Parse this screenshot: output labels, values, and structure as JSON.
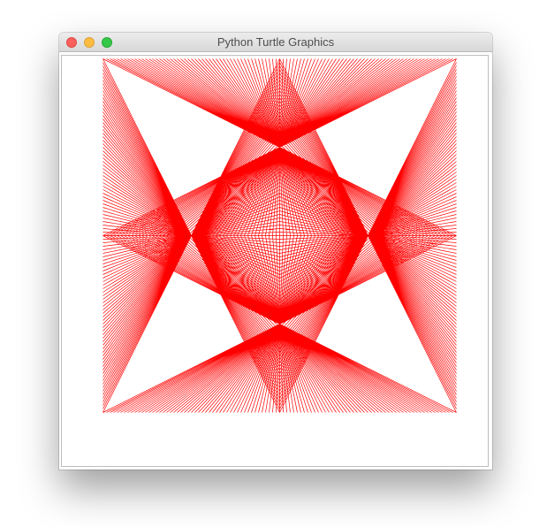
{
  "window": {
    "title": "Python Turtle Graphics",
    "controls": {
      "close": "close-button",
      "minimize": "minimize-button",
      "zoom": "zoom-button"
    }
  },
  "canvas": {
    "background_color": "#ffffff",
    "drawing": {
      "pattern": "string-art square star",
      "line_color": "#ff0000",
      "lines_per_edge": 100
    }
  }
}
